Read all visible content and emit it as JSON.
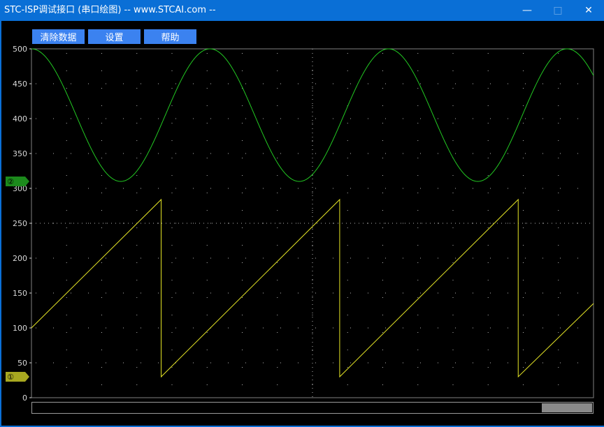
{
  "window": {
    "title": "STC-ISP调试接口 (串口绘图) -- www.STCAI.com --",
    "minimize_glyph": "—",
    "maximize_glyph": "□",
    "close_glyph": "✕"
  },
  "toolbar": {
    "clear_label": "清除数据",
    "settings_label": "设置",
    "help_label": "帮助"
  },
  "colors": {
    "title_bar": "#0a6fd6",
    "button": "#3b82f0",
    "channel1": "#e6e626",
    "channel2": "#22c822",
    "grid": "#b4b4b4"
  },
  "channel_markers": [
    {
      "label": "①",
      "y": 30,
      "color": "#a8a820"
    },
    {
      "label": "②",
      "y": 310,
      "color": "#1c8a1c"
    }
  ],
  "chart_data": {
    "type": "line",
    "ylim": [
      0,
      500
    ],
    "y_ticks": [
      0,
      50,
      100,
      150,
      200,
      250,
      300,
      350,
      400,
      450,
      500
    ],
    "grid": true,
    "series": [
      {
        "channel": "①",
        "color": "#e6e626",
        "points": [
          [
            0,
            100
          ],
          [
            93,
            284
          ],
          [
            93,
            30
          ],
          [
            221,
            284
          ],
          [
            221,
            30
          ],
          [
            349,
            284
          ],
          [
            349,
            30
          ],
          [
            403,
            135
          ]
        ]
      },
      {
        "channel": "②",
        "color": "#22c822",
        "wave": {
          "center": 405,
          "amplitude": 95,
          "period": 128,
          "peak_x": 0
        },
        "x_range": [
          0,
          403
        ]
      }
    ]
  }
}
